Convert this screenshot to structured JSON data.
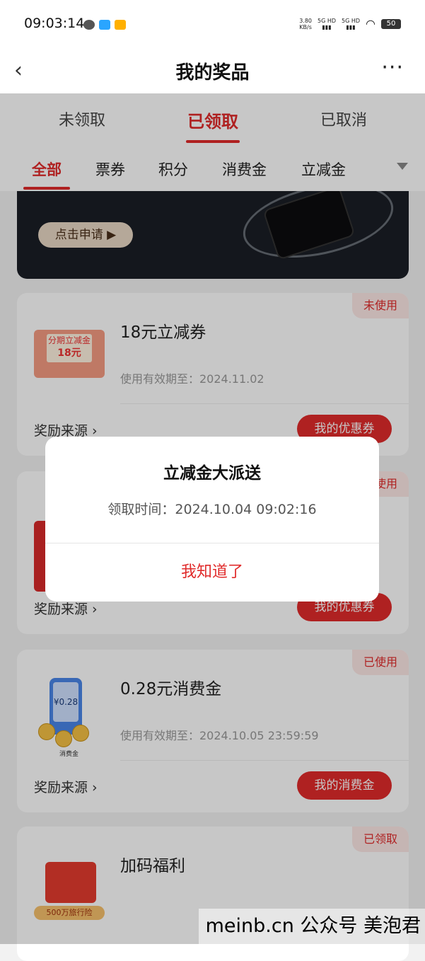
{
  "status": {
    "time": "09:03:14",
    "speed": "3.80",
    "speed_unit": "KB/s",
    "net1": "5G HD",
    "net2": "5G HD",
    "battery": "50"
  },
  "nav": {
    "title": "我的奖品"
  },
  "tabs": [
    "未领取",
    "已领取",
    "已取消"
  ],
  "subtabs": [
    "全部",
    "票券",
    "积分",
    "消费金",
    "立减金"
  ],
  "banner": {
    "button_label": "点击申请"
  },
  "cards": [
    {
      "badge": "未使用",
      "title": "18元立减券",
      "expiry": "使用有效期至：2024.11.02",
      "icon_text_top": "分期立减金",
      "icon_text_amount": "18元",
      "source": "奖励来源",
      "button": "我的优惠券"
    },
    {
      "badge": "使用",
      "source": "奖励来源",
      "button": "我的优惠券"
    },
    {
      "badge": "已使用",
      "title": "0.28元消费金",
      "expiry": "使用有效期至：2024.10.05 23:59:59",
      "icon_amount": "¥0.28",
      "icon_caption": "消费金",
      "source": "奖励来源",
      "button": "我的消费金"
    },
    {
      "badge": "已领取",
      "title": "加码福利",
      "icon_caption": "500万旅行险"
    }
  ],
  "modal": {
    "title": "立减金大派送",
    "text": "领取时间：2024.10.04 09:02:16",
    "button": "我知道了"
  },
  "watermark": "meinb.cn  公众号 美泡君",
  "colors": {
    "accent": "#e02b2b",
    "badge_bg": "#fde8e6"
  }
}
